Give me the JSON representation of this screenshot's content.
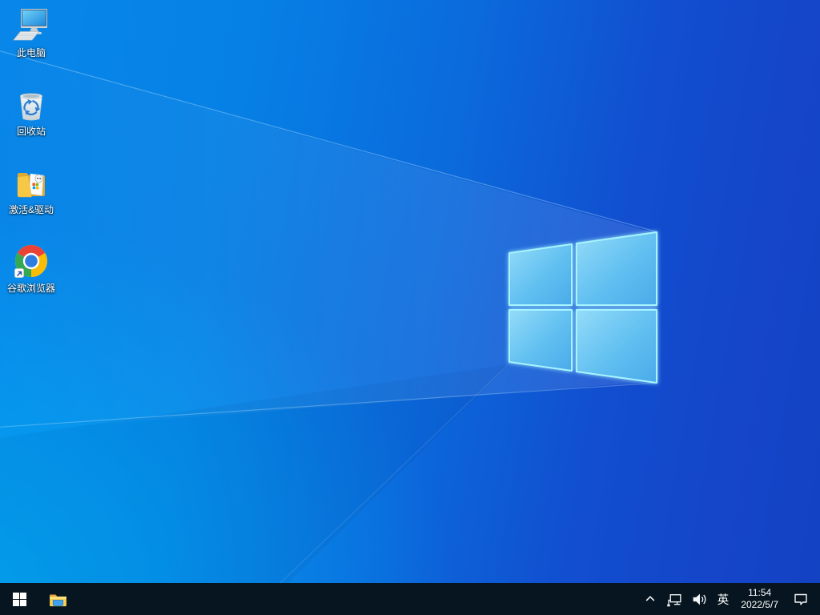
{
  "desktop": {
    "icons": [
      {
        "label": "此电脑",
        "icon": "this-pc-icon"
      },
      {
        "label": "回收站",
        "icon": "recycle-bin-icon"
      },
      {
        "label": "激活&驱动",
        "icon": "activation-drivers-folder-icon"
      },
      {
        "label": "谷歌浏览器",
        "icon": "google-chrome-icon"
      }
    ],
    "wallpaper": "windows-10-light-rays-logo"
  },
  "taskbar": {
    "start": {
      "icon": "windows-start-icon"
    },
    "pinned": [
      {
        "icon": "file-explorer-icon"
      }
    ],
    "tray": {
      "hidden_icons": {
        "icon": "chevron-up-icon"
      },
      "network": {
        "icon": "ethernet-network-icon"
      },
      "volume": {
        "icon": "speaker-volume-icon"
      },
      "language_indicator": "英",
      "clock": {
        "time": "11:54",
        "date": "2022/5/7"
      },
      "action_center": {
        "icon": "notification-bubble-icon"
      }
    }
  },
  "colors": {
    "wallpaper_left": "#00a3f0",
    "wallpaper_top_left": "#0887e9",
    "wallpaper_right": "#1443c8",
    "logo_pane_fill": "#55b6ee",
    "logo_edge_glow": "#9af2ff",
    "taskbar_bg": "#06151f",
    "tray_text": "#ffffff"
  }
}
